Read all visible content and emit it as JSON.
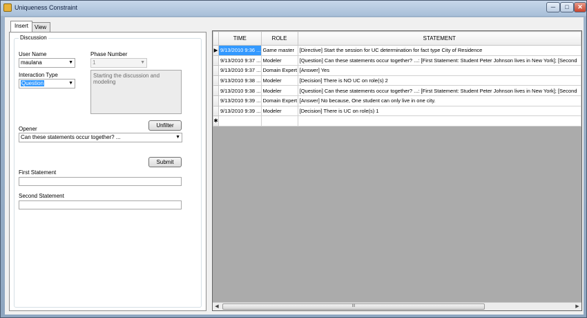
{
  "window": {
    "title": "Uniqueness Constraint",
    "controls": {
      "minimize": "─",
      "maximize": "□",
      "close": "✕"
    }
  },
  "tabs": [
    {
      "label": "Insert",
      "active": true
    },
    {
      "label": "View",
      "active": false
    }
  ],
  "discussion": {
    "group_label": "Discussion",
    "user_name_label": "User Name",
    "user_name_value": "maulana",
    "phase_number_label": "Phase Number",
    "phase_number_value": "1",
    "interaction_type_label": "Interaction Type",
    "interaction_type_value": "Question",
    "phase_description": "Starting the discussion and modeling",
    "unfilter_button": "Unfilter",
    "opener_label": "Opener",
    "opener_value": "Can these statements occur together? ...",
    "submit_button": "Submit",
    "first_statement_label": "First Statement",
    "first_statement_value": "",
    "second_statement_label": "Second Statement",
    "second_statement_value": ""
  },
  "grid": {
    "columns": [
      "TIME",
      "ROLE",
      "STATEMENT"
    ],
    "current_row_marker": "▶",
    "new_row_marker": "✱",
    "rows": [
      {
        "time": "9/13/2010 9:36 ...",
        "role": "Game master",
        "statement": "[Directive] Start the session for UC determination for fact type City of Residence"
      },
      {
        "time": "9/13/2010 9:37 ...",
        "role": "Modeler",
        "statement": "[Question] Can these statements occur together? ...: [First Statement: Student Peter Johnson lives in New York]; [Second"
      },
      {
        "time": "9/13/2010 9:37 ...",
        "role": "Domain Expert",
        "statement": "[Answer] Yes"
      },
      {
        "time": "9/13/2010 9:38 ...",
        "role": "Modeler",
        "statement": "[Decision] There is NO UC on role(s) 2"
      },
      {
        "time": "9/13/2010 9:38 ...",
        "role": "Modeler",
        "statement": "[Question] Can these statements occur together? ...: [First Statement: Student Peter Johnson lives in New York]; [Second"
      },
      {
        "time": "9/13/2010 9:39 ...",
        "role": "Domain Expert",
        "statement": "[Answer] No because, One student can only live in one city."
      },
      {
        "time": "9/13/2010 9:39 ...",
        "role": "Modeler",
        "statement": "[Decision] There is UC on role(s) 1"
      }
    ],
    "scroll_thumb_grip": "III"
  }
}
